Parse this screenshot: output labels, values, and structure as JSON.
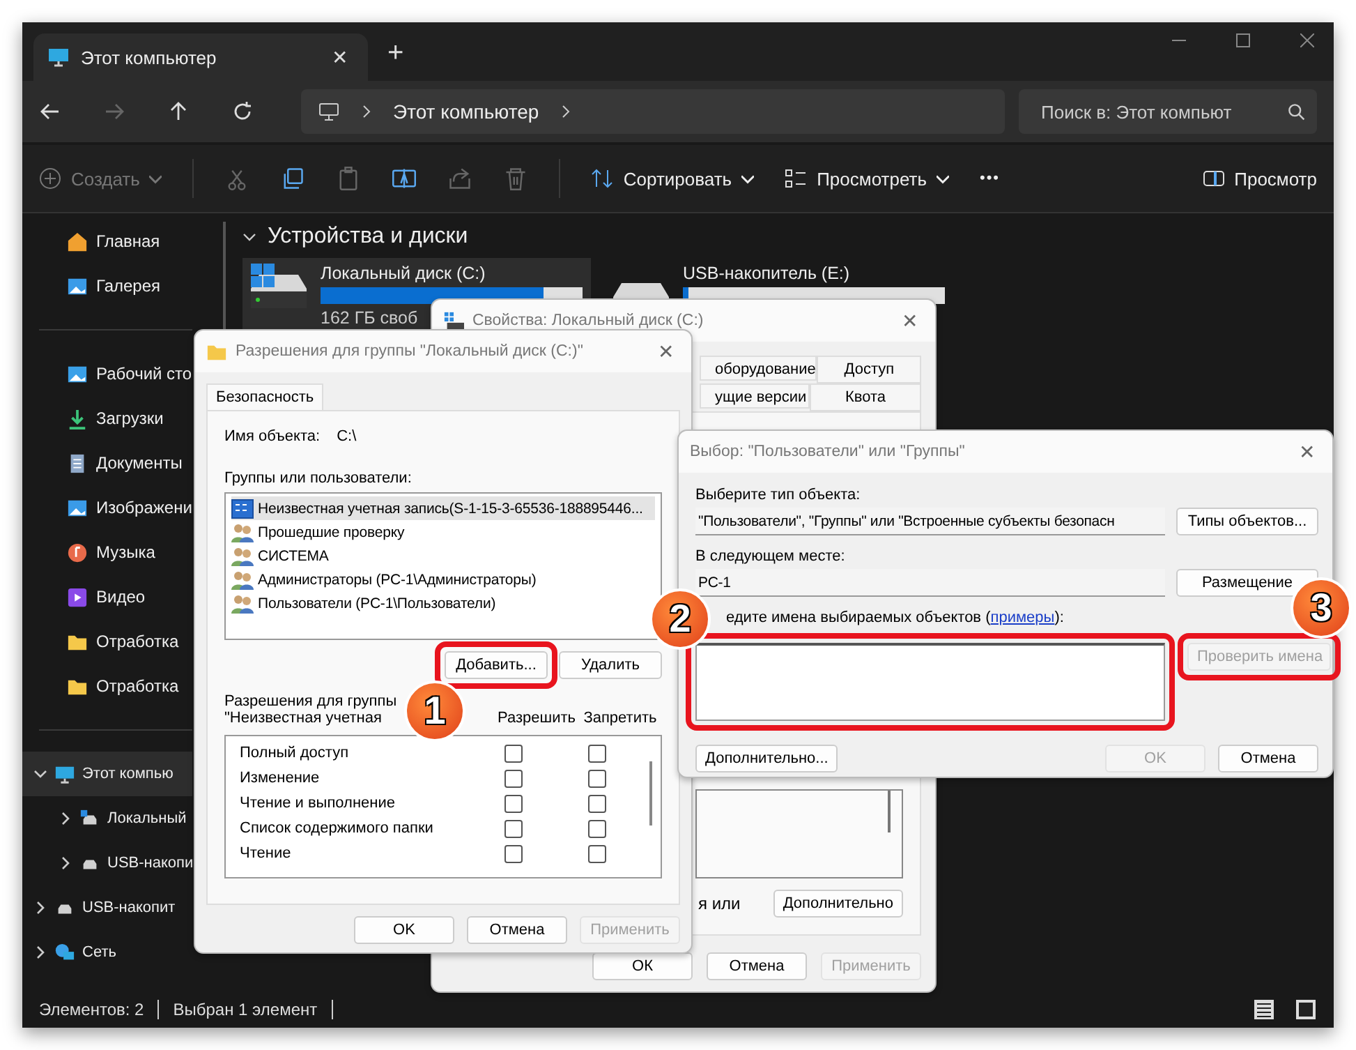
{
  "explorer": {
    "tab": {
      "title": "Этот компьютер",
      "close": "✕"
    },
    "new_tab": "+",
    "address": {
      "crumbs": [
        "Этот компьютер"
      ]
    },
    "search": {
      "placeholder": "Поиск в: Этот компьют"
    },
    "toolbar": {
      "create": {
        "label": "Создать",
        "disabled": true
      },
      "actions": [
        {
          "kind": "cut",
          "disabled": true
        },
        {
          "kind": "copy",
          "disabled": false
        },
        {
          "kind": "paste",
          "disabled": true
        },
        {
          "kind": "rename",
          "disabled": false
        },
        {
          "kind": "share",
          "disabled": true
        },
        {
          "kind": "delete",
          "disabled": true
        }
      ],
      "sort": "Сортировать",
      "view": "Просмотреть",
      "more": "•••",
      "preview": "Просмотр"
    },
    "sidebar": {
      "quick": [
        {
          "label": "Главная",
          "kind": "home"
        },
        {
          "label": "Галерея",
          "kind": "gallery"
        }
      ],
      "pinned": [
        {
          "label": "Рабочий сто",
          "kind": "desktop"
        },
        {
          "label": "Загрузки",
          "kind": "downloads"
        },
        {
          "label": "Документы",
          "kind": "documents"
        },
        {
          "label": "Изображени",
          "kind": "pictures"
        },
        {
          "label": "Музыка",
          "kind": "music"
        },
        {
          "label": "Видео",
          "kind": "video"
        },
        {
          "label": "Отработка",
          "kind": "folder"
        },
        {
          "label": "Отработка",
          "kind": "folder"
        }
      ],
      "tree": [
        {
          "label": "Этот компью",
          "kind": "computer",
          "expanded": true,
          "selected": true,
          "children": [
            {
              "label": "Локальный",
              "kind": "windrive",
              "expanded": false,
              "selected": false
            },
            {
              "label": "USB-накопи",
              "kind": "drive",
              "expanded": false,
              "selected": false
            }
          ]
        },
        {
          "label": "USB-накопит",
          "kind": "drive",
          "expanded": false,
          "selected": false
        },
        {
          "label": "Сеть",
          "kind": "network",
          "expanded": false,
          "selected": false
        }
      ]
    },
    "section": {
      "title": "Устройства и диски",
      "expanded": true
    },
    "drives": [
      {
        "name": "Локальный диск (C:)",
        "kind": "windrive",
        "level": 0.85,
        "free": "162 ГБ своб",
        "selected": true
      },
      {
        "name": "USB-накопитель (E:)",
        "kind": "drive",
        "level": 0.02,
        "selected": false
      }
    ],
    "status": [
      "Элементов: 2",
      "Выбран 1 элемент"
    ]
  },
  "properties": {
    "title": "Свойства: Локальный диск (C:)",
    "close": "✕",
    "tabs": [
      [
        "оборудование",
        "Доступ"
      ],
      [
        "ущие версии",
        "Квота"
      ]
    ],
    "advanced_text": "я или",
    "advanced": "Дополнительно",
    "buttons": [
      {
        "label": "ОК",
        "disabled": false
      },
      {
        "label": "Отмена",
        "disabled": false
      },
      {
        "label": "Применить",
        "disabled": true
      }
    ]
  },
  "permissions": {
    "title": "Разрешения для группы \"Локальный диск (C:)\"",
    "close": "✕",
    "tab": {
      "label": "Безопасность",
      "selected": true
    },
    "object_label": "Имя объекта:",
    "object_value": "C:\\",
    "groups_label": "Группы или пользователи:",
    "users": [
      {
        "name": "Неизвестная учетная запись(S-1-15-3-65536-188895446...",
        "kind": "account",
        "selected": true
      },
      {
        "name": "Прошедшие проверку",
        "kind": "group",
        "selected": false
      },
      {
        "name": "СИСТЕМА",
        "kind": "group",
        "selected": false
      },
      {
        "name": "Администраторы (PC-1\\Администраторы)",
        "kind": "group",
        "selected": false
      },
      {
        "name": "Пользователи (PC-1\\Пользователи)",
        "kind": "group",
        "selected": false
      }
    ],
    "add": "Добавить...",
    "remove": "Удалить",
    "perm_label": [
      "Разрешения для группы",
      "\"Неизвестная учетная"
    ],
    "allow": "Разрешить",
    "deny": "Запретить",
    "perms": [
      {
        "name": "Полный доступ",
        "allow": false,
        "deny": false
      },
      {
        "name": "Изменение",
        "allow": false,
        "deny": false
      },
      {
        "name": "Чтение и выполнение",
        "allow": false,
        "deny": false
      },
      {
        "name": "Список содержимого папки",
        "allow": false,
        "deny": false
      },
      {
        "name": "Чтение",
        "allow": false,
        "deny": false
      }
    ],
    "buttons": [
      {
        "label": "OK",
        "disabled": false
      },
      {
        "label": "Отмена",
        "disabled": false
      },
      {
        "label": "Применить",
        "disabled": true
      }
    ]
  },
  "select": {
    "title": "Выбор: \"Пользователи\" или \"Группы\"",
    "close": "✕",
    "type_label": "Выберите тип объекта:",
    "type_value": "\"Пользователи\", \"Группы\" или \"Встроенные субъекты безопасн",
    "types_button": "Типы объектов...",
    "location_label": "В следующем месте:",
    "location_value": "PC-1",
    "location_button": "Размещение",
    "names_label": {
      "text": "едите имена выбираемых объектов (",
      "link": "примеры",
      "suffix": "):"
    },
    "check_button": {
      "label": "Проверить имена",
      "disabled": true
    },
    "advanced": "Дополнительно...",
    "buttons": [
      {
        "label": "OK",
        "disabled": true
      },
      {
        "label": "Отмена",
        "disabled": false
      }
    ]
  },
  "callouts": [
    "1",
    "2",
    "3"
  ]
}
